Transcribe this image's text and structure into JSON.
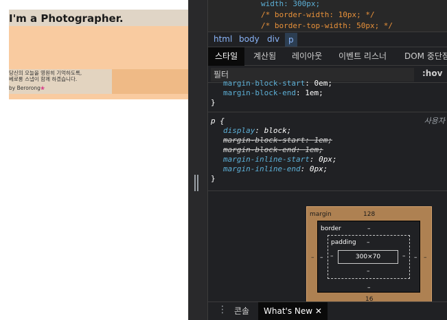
{
  "preview": {
    "title": "I'm a Photographer.",
    "desc_line1": "당신의 오늘을 영원히 기억하도록,",
    "desc_line2": "베로롱 스냅이 함께 하겠습니다.",
    "byline": "by Berorong",
    "flower": "❀"
  },
  "code_top": {
    "line1": "width: 300px;",
    "line2": "/* border-width: 10px; */",
    "line3": "/* border-top-width: 50px; */"
  },
  "breadcrumbs": [
    "html",
    "body",
    "div",
    "p"
  ],
  "tabs": {
    "styles": "스타일",
    "computed": "계산됨",
    "layout": "레이아웃",
    "event_listeners": "이벤트 리스너",
    "dom_breakpoints": "DOM 중단점"
  },
  "filter": {
    "placeholder": "필터",
    "hov": ":hov"
  },
  "styles": {
    "prev_rule": [
      {
        "name": "margin-block-start",
        "value": "0em;"
      },
      {
        "name": "margin-block-end",
        "value": "1em;"
      }
    ],
    "close_brace": "}",
    "p_selector": "p {",
    "user_agent_label": "사용자",
    "p_props": [
      {
        "name": "display",
        "value": "block;",
        "struck": false
      },
      {
        "name": "margin-block-start",
        "value": "1em;",
        "struck": true
      },
      {
        "name": "margin-block-end",
        "value": "1em;",
        "struck": true
      },
      {
        "name": "margin-inline-start",
        "value": "0px;",
        "struck": false
      },
      {
        "name": "margin-inline-end",
        "value": "0px;",
        "struck": false
      }
    ]
  },
  "box_model": {
    "margin_label": "margin",
    "margin_top": "128",
    "margin_bottom": "16",
    "margin_left": "–",
    "margin_right": "–",
    "border_label": "border",
    "border_top": "–",
    "border_bottom": "–",
    "border_left": "–",
    "border_right": "–",
    "padding_label": "padding",
    "padding_top": "–",
    "padding_bottom": "–",
    "padding_left": "–",
    "padding_right": "–",
    "content": "300×70"
  },
  "drawer": {
    "console": "콘솔",
    "whats_new": "What's New",
    "close": "✕"
  }
}
